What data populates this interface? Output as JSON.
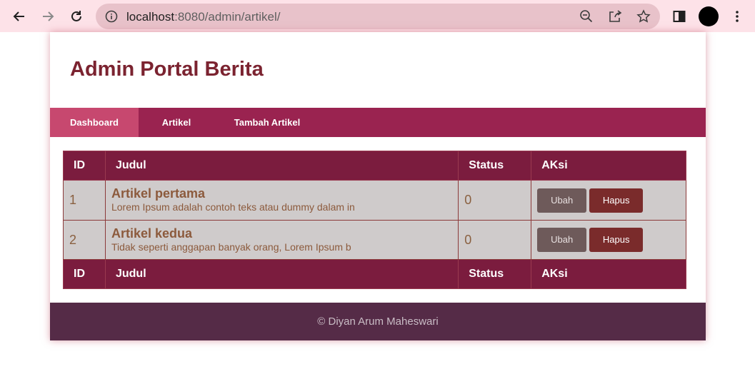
{
  "browser": {
    "url_host": "localhost",
    "url_rest": ":8080/admin/artikel/",
    "icons": [
      "back-arrow-icon",
      "forward-arrow-icon",
      "reload-icon",
      "info-icon",
      "zoom-out-icon",
      "share-icon",
      "star-icon",
      "side-panel-icon",
      "profile-avatar",
      "more-vert-icon"
    ]
  },
  "header": {
    "title": "Admin Portal Berita"
  },
  "nav": {
    "items": [
      {
        "label": "Dashboard",
        "active": true
      },
      {
        "label": "Artikel",
        "active": false
      },
      {
        "label": "Tambah Artikel",
        "active": false
      }
    ]
  },
  "table": {
    "columns": [
      "ID",
      "Judul",
      "Status",
      "AKsi"
    ],
    "rows": [
      {
        "id": "1",
        "title": "Artikel pertama",
        "desc": "Lorem Ipsum adalah contoh teks atau dummy dalam in",
        "status": "0",
        "edit_label": "Ubah",
        "delete_label": "Hapus"
      },
      {
        "id": "2",
        "title": "Artikel kedua",
        "desc": "Tidak seperti anggapan banyak orang, Lorem Ipsum b",
        "status": "0",
        "edit_label": "Ubah",
        "delete_label": "Hapus"
      }
    ]
  },
  "footer": {
    "text": "© Diyan Arum Maheswari"
  },
  "colors": {
    "nav_bg": "#9a2350",
    "nav_active": "#c7486f",
    "table_header": "#7b1c3e",
    "title": "#7b2330",
    "footer_bg": "#552b47"
  }
}
